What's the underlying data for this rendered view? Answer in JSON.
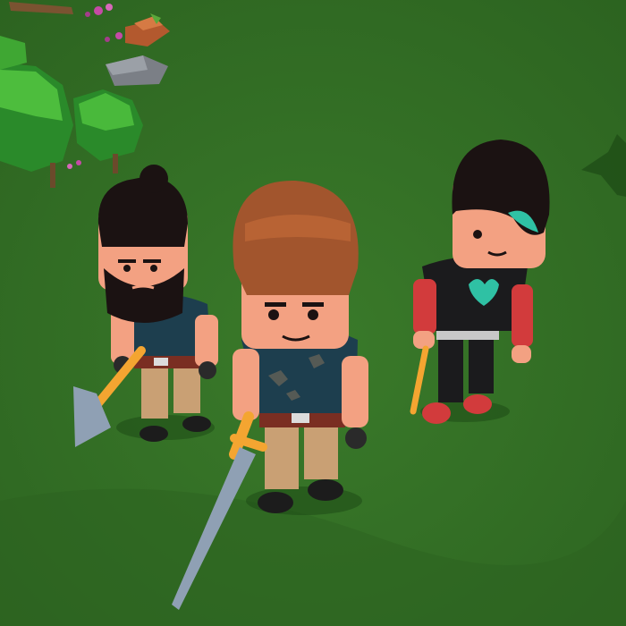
{
  "scene": {
    "type": "low-poly 3D game scene, top-down perspective",
    "ground_color": "#2f6a22",
    "characters": [
      {
        "name": "bearded-axeman",
        "weapon": "axe"
      },
      {
        "name": "brown-hair-swordsman",
        "weapon": "sword"
      },
      {
        "name": "black-hair-girl",
        "weapon": "staff"
      }
    ],
    "props": [
      "bush",
      "bush",
      "rock",
      "stump",
      "flower-patch",
      "palm-shadow"
    ]
  },
  "colors": {
    "grass": "#2f6a22",
    "shirt": "#1d3e4e",
    "pants": "#c9a074",
    "skin": "#f3a182",
    "weapon_handle": "#f4a531",
    "blade": "#8fa0b4",
    "black_outfit": "#1b1b1d",
    "red_sleeve": "#d23b3c",
    "heart": "#2fc1a4"
  }
}
